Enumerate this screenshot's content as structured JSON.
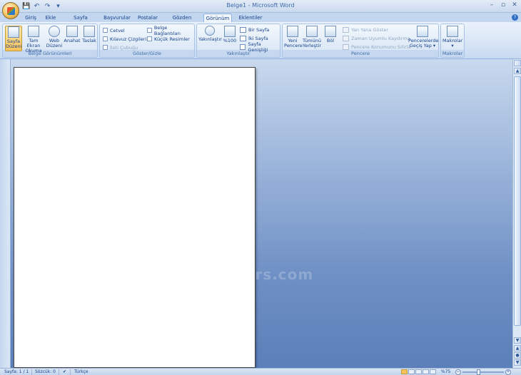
{
  "window": {
    "title": "Belge1 - Microsoft Word",
    "minimize": "–",
    "maximize": "▫",
    "close": "✕"
  },
  "qat": {
    "save": "💾",
    "undo": "↶",
    "redo": "↷",
    "more": "▾"
  },
  "tabs": [
    "Giriş",
    "Ekle",
    "Sayfa Düzeni",
    "Başvurular",
    "Postalar",
    "Gözden Geçir",
    "Görünüm",
    "Eklentiler"
  ],
  "active_tab": "Görünüm",
  "help": "?",
  "ribbon": {
    "belge_gorunumleri": {
      "label": "Belge Görünümleri",
      "buttons": [
        {
          "line1": "Sayfa",
          "line2": "Düzeni",
          "selected": true
        },
        {
          "line1": "Tam Ekran",
          "line2": "Okuma"
        },
        {
          "line1": "Web",
          "line2": "Düzeni"
        },
        {
          "line1": "Anahat",
          "line2": ""
        },
        {
          "line1": "Taslak",
          "line2": ""
        }
      ]
    },
    "goster_gizle": {
      "label": "Göster/Gizle",
      "items": [
        {
          "text": "Cetvel",
          "disabled": false
        },
        {
          "text": "Kılavuz Çizgileri",
          "disabled": false
        },
        {
          "text": "İleti Çubuğu",
          "disabled": true
        },
        {
          "text": "Belge Bağlantıları",
          "disabled": false
        },
        {
          "text": "Küçük Resimler",
          "disabled": false
        }
      ]
    },
    "yakinlastir": {
      "label": "Yakınlaştır",
      "zoom_btn": "Yakınlaştır",
      "hundred_btn": "%100",
      "small": [
        "Bir Sayfa",
        "İki Sayfa",
        "Sayfa Genişliği"
      ]
    },
    "pencere": {
      "label": "Pencere",
      "buttons": [
        {
          "line1": "Yeni",
          "line2": "Pencere"
        },
        {
          "line1": "Tümünü",
          "line2": "Yerleştir"
        },
        {
          "line1": "Böl",
          "line2": ""
        }
      ],
      "small": [
        "Yan Yana Göster",
        "Zaman Uyumlu Kaydırma",
        "Pencere Konumunu Sıfırla"
      ],
      "switch_btn": {
        "line1": "Pencerelerde",
        "line2": "Geçiş Yap ▾"
      }
    },
    "makrolar": {
      "label": "Makrolar",
      "button": {
        "line1": "Makrolar",
        "line2": "▾"
      }
    }
  },
  "watermark": "www.dijitalders.com",
  "status": {
    "page": "Sayfa: 1 / 1",
    "words": "Sözcük: 0",
    "language": "Türkçe",
    "zoom": "%75",
    "zoom_minus": "−",
    "zoom_plus": "+"
  },
  "scroll": {
    "up": "▲",
    "down": "▼",
    "prev": "▲",
    "next": "▼",
    "select": "●"
  }
}
